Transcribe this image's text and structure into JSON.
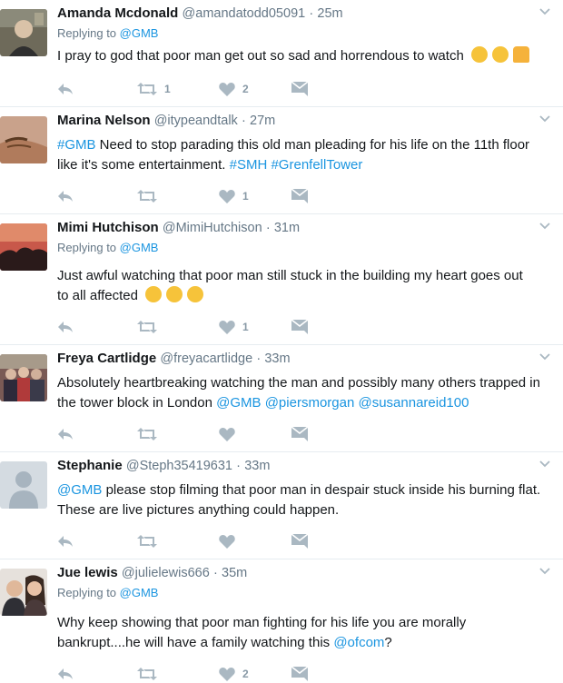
{
  "tweets": [
    {
      "name": "Amanda Mcdonald",
      "handle": "@amandatodd05091",
      "time": "25m",
      "replying_prefix": "Replying to ",
      "replying_to": "@GMB",
      "line1": "I pray to god that poor man get out so sad and horrendous to watch",
      "emojis": [
        "face-screaming-in-fear",
        "loudly-crying-face",
        "folded-hands"
      ],
      "retweets": "1",
      "likes": "2"
    },
    {
      "name": "Marina Nelson",
      "handle": "@itypeandtalk",
      "time": "27m",
      "line1_tag": "#GMB",
      "line1_text": " Need to stop parading this old man pleading for his life on the 11th floor",
      "line2_text": "like it's some entertainment. ",
      "line2_tag1": "#SMH",
      "line2_tag2": "#GrenfellTower",
      "retweets": "",
      "likes": "1"
    },
    {
      "name": "Mimi Hutchison",
      "handle": "@MimiHutchison",
      "time": "31m",
      "replying_prefix": "Replying to ",
      "replying_to": "@GMB",
      "line1": "Just awful watching that poor man still stuck  in the building my heart goes out",
      "line2": "to all affected",
      "emojis": [
        "sad-face",
        "sad-face",
        "sad-face"
      ],
      "retweets": "",
      "likes": "1"
    },
    {
      "name": "Freya Cartlidge",
      "handle": "@freyacartlidge",
      "time": "33m",
      "line1": "Absolutely heartbreaking watching the man and possibly many others trapped in",
      "line2_text": "the tower block in London ",
      "line2_m1": "@GMB",
      "line2_m2": "@piersmorgan",
      "line2_m3": "@susannareid100",
      "retweets": "",
      "likes": ""
    },
    {
      "name": "Stephanie",
      "handle": "@Steph35419631",
      "time": "33m",
      "line1_mention": "@GMB",
      "line1_text": " please stop filming that poor man in despair stuck inside his burning flat.",
      "line2": "These are live pictures anything could happen.",
      "retweets": "",
      "likes": ""
    },
    {
      "name": "Jue lewis",
      "handle": "@julielewis666",
      "time": "35m",
      "replying_prefix": "Replying to ",
      "replying_to": "@GMB",
      "line1": "Why keep showing that poor man fighting for his life you are morally",
      "line2_text": "bankrupt....he will have a family watching this ",
      "line2_mention": "@ofcom",
      "line2_suffix": "?",
      "retweets": "",
      "likes": "2"
    }
  ],
  "separator": "·",
  "colors": {
    "link": "#1b95e0",
    "muted": "#657786",
    "icon": "#aab8c2",
    "divider": "#e6ecf0"
  }
}
